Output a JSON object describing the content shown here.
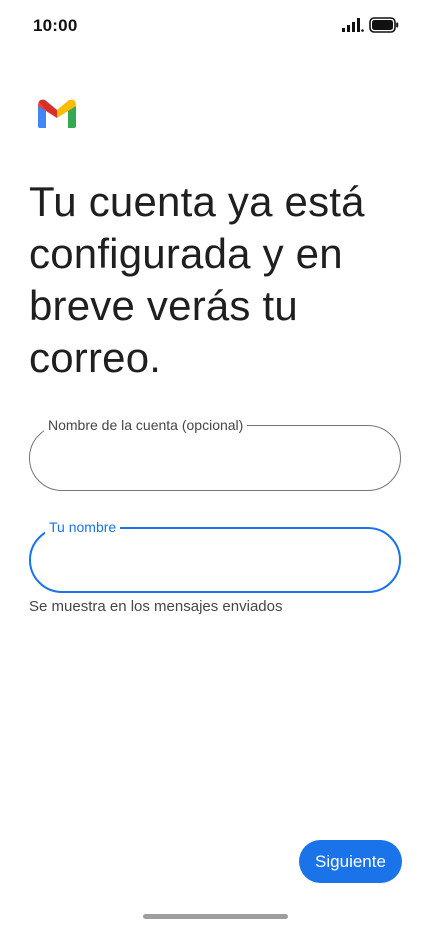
{
  "status_bar": {
    "time": "10:00",
    "signal_icon": "signal-icon",
    "battery_icon": "battery-icon"
  },
  "app": {
    "logo_icon": "gmail-logo",
    "brand_colors": [
      "#4285F4",
      "#EA4335",
      "#FBBC04",
      "#34A853",
      "#C5221F"
    ]
  },
  "headline": "Tu cuenta ya está configurada y en breve verás tu correo.",
  "form": {
    "account_name": {
      "label": "Nombre de la cuenta (opcional)",
      "value": ""
    },
    "your_name": {
      "label": "Tu nombre",
      "value": "",
      "helper": "Se muestra en los mensajes enviados",
      "focused": true
    }
  },
  "actions": {
    "next_label": "Siguiente"
  },
  "colors": {
    "accent": "#1a73e8",
    "outline": "#747775",
    "text": "#1f1f1f",
    "helper": "#444746"
  }
}
